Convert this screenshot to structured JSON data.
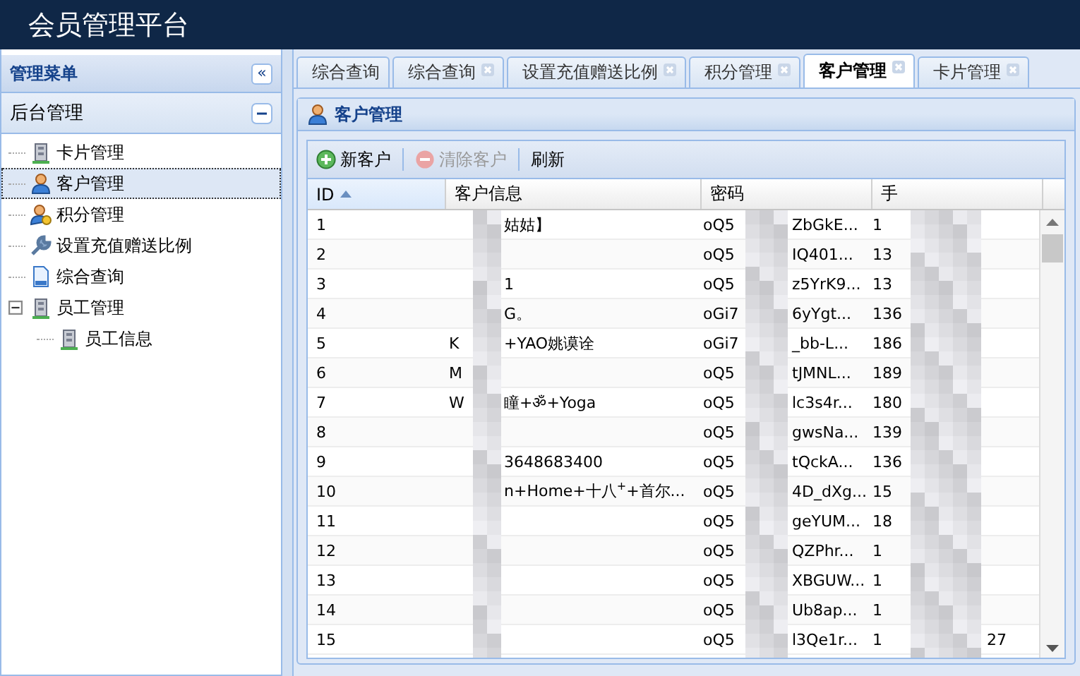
{
  "header": {
    "title": "会员管理平台"
  },
  "sidebar": {
    "title": "管理菜单",
    "collapse_label": "«",
    "group": {
      "label": "后台管理",
      "expanded": true,
      "items": [
        {
          "label": "卡片管理",
          "kind": "card",
          "selected": false
        },
        {
          "label": "客户管理",
          "kind": "customer",
          "selected": true
        },
        {
          "label": "积分管理",
          "kind": "points",
          "selected": false
        },
        {
          "label": "设置充值赠送比例",
          "kind": "settings",
          "selected": false
        },
        {
          "label": "综合查询",
          "kind": "query",
          "selected": false
        },
        {
          "label": "员工管理",
          "kind": "card",
          "selected": false,
          "expanded": true,
          "children": [
            {
              "label": "员工信息",
              "kind": "card",
              "selected": false
            }
          ]
        }
      ]
    }
  },
  "tabs": [
    {
      "label": "综合查询",
      "closable": false,
      "selected": false
    },
    {
      "label": "综合查询",
      "closable": true,
      "selected": false
    },
    {
      "label": "设置充值赠送比例",
      "closable": true,
      "selected": false
    },
    {
      "label": "积分管理",
      "closable": true,
      "selected": false
    },
    {
      "label": "客户管理",
      "closable": true,
      "selected": true
    },
    {
      "label": "卡片管理",
      "closable": true,
      "selected": false
    }
  ],
  "panel": {
    "title": "客户管理"
  },
  "toolbar": [
    {
      "label": "新客户",
      "kind": "add",
      "disabled": false
    },
    {
      "label": "清除客户",
      "kind": "remove",
      "disabled": true
    },
    {
      "label": "刷新",
      "kind": "plain",
      "disabled": false
    }
  ],
  "table": {
    "columns": [
      {
        "label": "ID",
        "sorted": true
      },
      {
        "label": "客户信息",
        "sorted": false
      },
      {
        "label": "密码",
        "sorted": false
      },
      {
        "label": "手",
        "sorted": false
      }
    ],
    "rows": [
      {
        "id": "1",
        "info": {
          "end": "姑姑】"
        },
        "password": {
          "start": "oQ5",
          "end": "ZbGkE..."
        },
        "phone": {
          "start": "1"
        }
      },
      {
        "id": "2",
        "password": {
          "start": "oQ5",
          "end": "IQ401..."
        },
        "phone": {
          "start": "13"
        }
      },
      {
        "id": "3",
        "info": {
          "end": "1"
        },
        "password": {
          "start": "oQ5",
          "end": "z5YrK9..."
        },
        "phone": {
          "start": "13"
        }
      },
      {
        "id": "4",
        "info": {
          "end": "G。"
        },
        "password": {
          "start": "oGi7",
          "end": "6yYgt..."
        },
        "phone": {
          "start": "136"
        }
      },
      {
        "id": "5",
        "info": {
          "start": "K",
          "end": "+YAO姚谟诠"
        },
        "password": {
          "start": "oGi7",
          "end": "_bb-L..."
        },
        "phone": {
          "start": "186"
        }
      },
      {
        "id": "6",
        "info": {
          "start": "M"
        },
        "password": {
          "start": "oQ5",
          "end": "tJMNL..."
        },
        "phone": {
          "start": "189"
        }
      },
      {
        "id": "7",
        "info": {
          "start": "W",
          "end": "瞳+ॐ+Yoga"
        },
        "password": {
          "start": "oQ5",
          "end": "lc3s4r..."
        },
        "phone": {
          "start": "180"
        }
      },
      {
        "id": "8",
        "password": {
          "start": "oQ5",
          "end": "gwsNa..."
        },
        "phone": {
          "start": "139"
        }
      },
      {
        "id": "9",
        "info": {
          "end": "3648683400"
        },
        "password": {
          "start": "oQ5",
          "end": "tQckA..."
        },
        "phone": {
          "start": "136"
        }
      },
      {
        "id": "10",
        "info": {
          "end": "n+Home+十八$^{+}$+首尔..."
        },
        "password": {
          "start": "oQ5",
          "end": "4D_dXg..."
        },
        "phone": {
          "start": "15"
        }
      },
      {
        "id": "11",
        "password": {
          "start": "oQ5",
          "end": "geYUM..."
        },
        "phone": {
          "start": "18"
        }
      },
      {
        "id": "12",
        "password": {
          "start": "oQ5",
          "end": "QZPhr..."
        },
        "phone": {
          "start": "1"
        }
      },
      {
        "id": "13",
        "password": {
          "start": "oQ5",
          "end": "XBGUW..."
        },
        "phone": {
          "start": "1"
        }
      },
      {
        "id": "14",
        "password": {
          "start": "oQ5",
          "end": "Ub8ap..."
        },
        "phone": {
          "start": "1"
        }
      },
      {
        "id": "15",
        "password": {
          "start": "oQ5",
          "end": "l3Qe1r..."
        },
        "phone": {
          "start": "1",
          "end": "27"
        }
      }
    ]
  }
}
